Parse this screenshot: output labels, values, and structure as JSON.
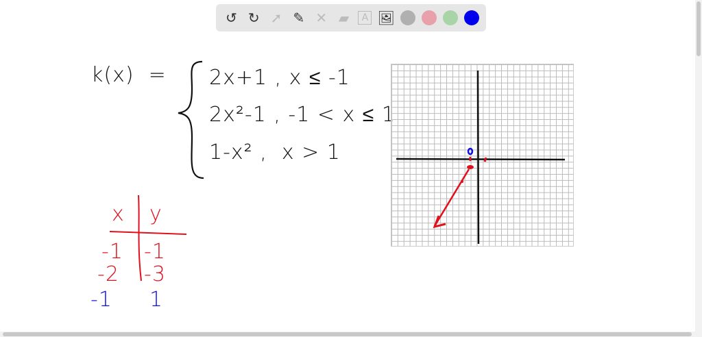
{
  "toolbar": {
    "tools": [
      "undo-icon",
      "redo-icon",
      "select-icon",
      "pen-icon",
      "tools-icon",
      "eraser-icon",
      "text-icon",
      "image-icon"
    ],
    "colors": [
      "#b0b0b0",
      "#e8a0aa",
      "#a8d4a8",
      "#0000ee"
    ]
  },
  "board": {
    "func": "k(x)  =",
    "cases": [
      "2x+1 , x ≤ -1",
      "2x²-1 , -1 < x ≤ 1",
      "1-x² ,  x > 1"
    ],
    "table": {
      "headers": [
        "x",
        "y"
      ],
      "rows": [
        [
          "-1",
          "-1"
        ],
        [
          "-2",
          "-3"
        ]
      ],
      "extra_row": [
        "-1",
        "1"
      ]
    },
    "ink_colors": {
      "black": "#111111",
      "red": "#e0101c",
      "blue": "#1010e0"
    }
  }
}
